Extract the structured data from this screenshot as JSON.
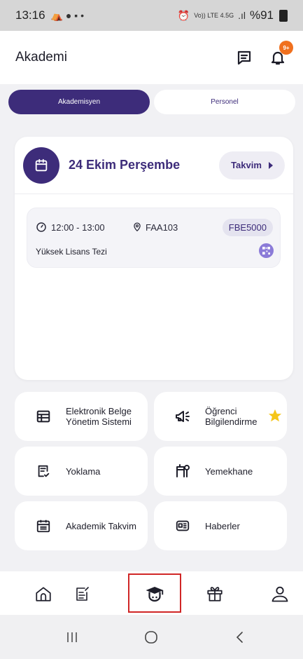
{
  "status_bar": {
    "time": "13:16",
    "signal_text": "%91",
    "network_label": "Vo)) LTE 4.5G"
  },
  "header": {
    "title": "Akademi",
    "notification_badge": "9+"
  },
  "tabs": [
    {
      "label": "Akademisyen",
      "active": true
    },
    {
      "label": "Personel",
      "active": false
    }
  ],
  "schedule": {
    "date": "24 Ekim Perşembe",
    "calendar_button": "Takvim",
    "classes": [
      {
        "time": "12:00 - 13:00",
        "room": "FAA103",
        "code": "FBE5000",
        "title": "Yüksek Lisans Tezi"
      }
    ]
  },
  "menu_tiles": [
    {
      "label_line1": "Elektronik Belge",
      "label_line2": "Yönetim Sistemi",
      "icon": "table-icon"
    },
    {
      "label_line1": "Öğrenci",
      "label_line2": "Bilgilendirme",
      "icon": "megaphone-icon",
      "starred": true
    },
    {
      "label_line1": "Yoklama",
      "label_line2": "",
      "icon": "checklist-icon"
    },
    {
      "label_line1": "Yemekhane",
      "label_line2": "",
      "icon": "restaurant-icon"
    },
    {
      "label_line1": "Akademik Takvim",
      "label_line2": "",
      "icon": "calendar-grid-icon"
    },
    {
      "label_line1": "Haberler",
      "label_line2": "",
      "icon": "news-icon"
    }
  ],
  "bottom_nav": [
    {
      "icon": "home-icon"
    },
    {
      "icon": "edit-document-icon"
    },
    {
      "icon": "graduate-icon",
      "active": true
    },
    {
      "icon": "gift-icon"
    },
    {
      "icon": "profile-icon"
    }
  ],
  "colors": {
    "primary": "#3d2c7a",
    "badge": "#f0701e",
    "star": "#f5c518",
    "highlight_box": "#d02626"
  }
}
